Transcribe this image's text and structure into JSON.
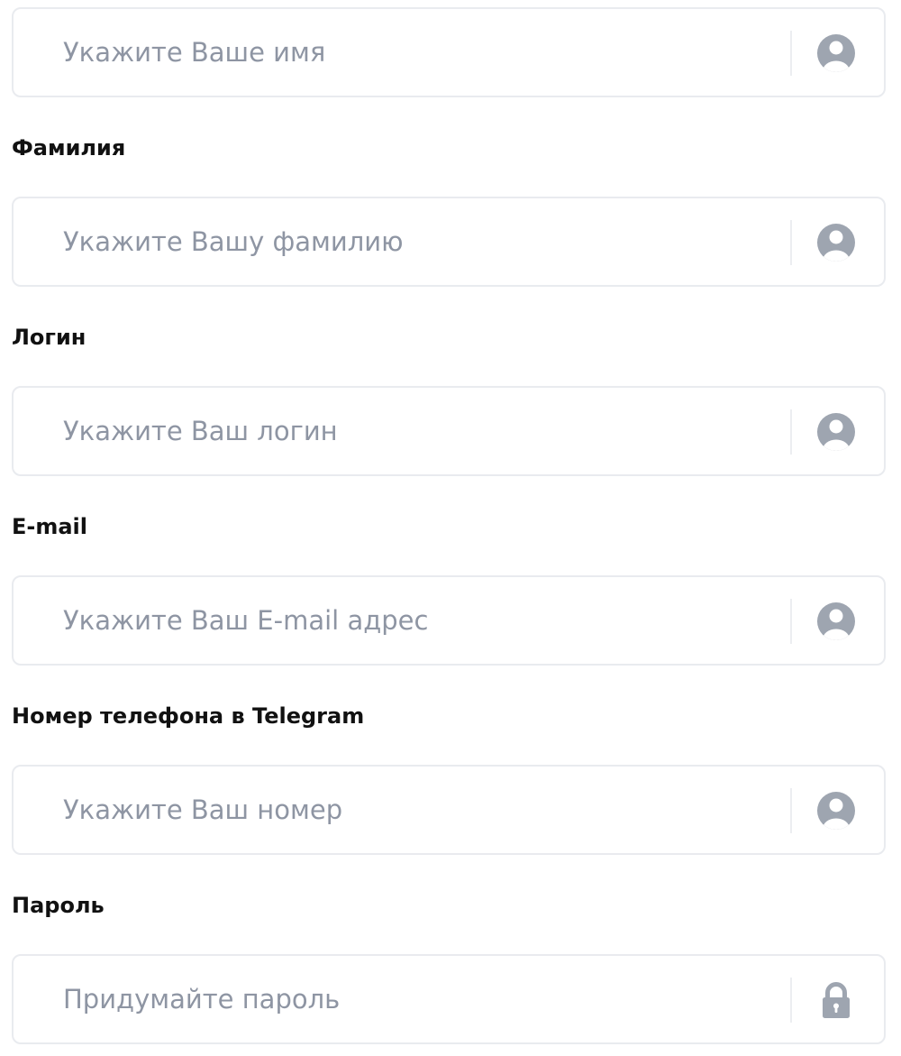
{
  "colors": {
    "icon": "#9ea5b0",
    "placeholder": "#8e95a3",
    "border": "#e9ebef",
    "label": "#111111"
  },
  "fields": [
    {
      "label": "",
      "placeholder": "Укажите Ваше имя",
      "value": "",
      "icon": "user-icon"
    },
    {
      "label": "Фамилия",
      "placeholder": "Укажите Вашу фамилию",
      "value": "",
      "icon": "user-icon"
    },
    {
      "label": "Логин",
      "placeholder": "Укажите Ваш логин",
      "value": "",
      "icon": "user-icon"
    },
    {
      "label": "E-mail",
      "placeholder": "Укажите Ваш E-mail адрес",
      "value": "",
      "icon": "user-icon"
    },
    {
      "label": "Номер телефона в Telegram",
      "placeholder": "Укажите Ваш номер",
      "value": "",
      "icon": "user-icon"
    },
    {
      "label": "Пароль",
      "placeholder": "Придумайте пароль",
      "value": "",
      "icon": "lock-icon"
    }
  ]
}
